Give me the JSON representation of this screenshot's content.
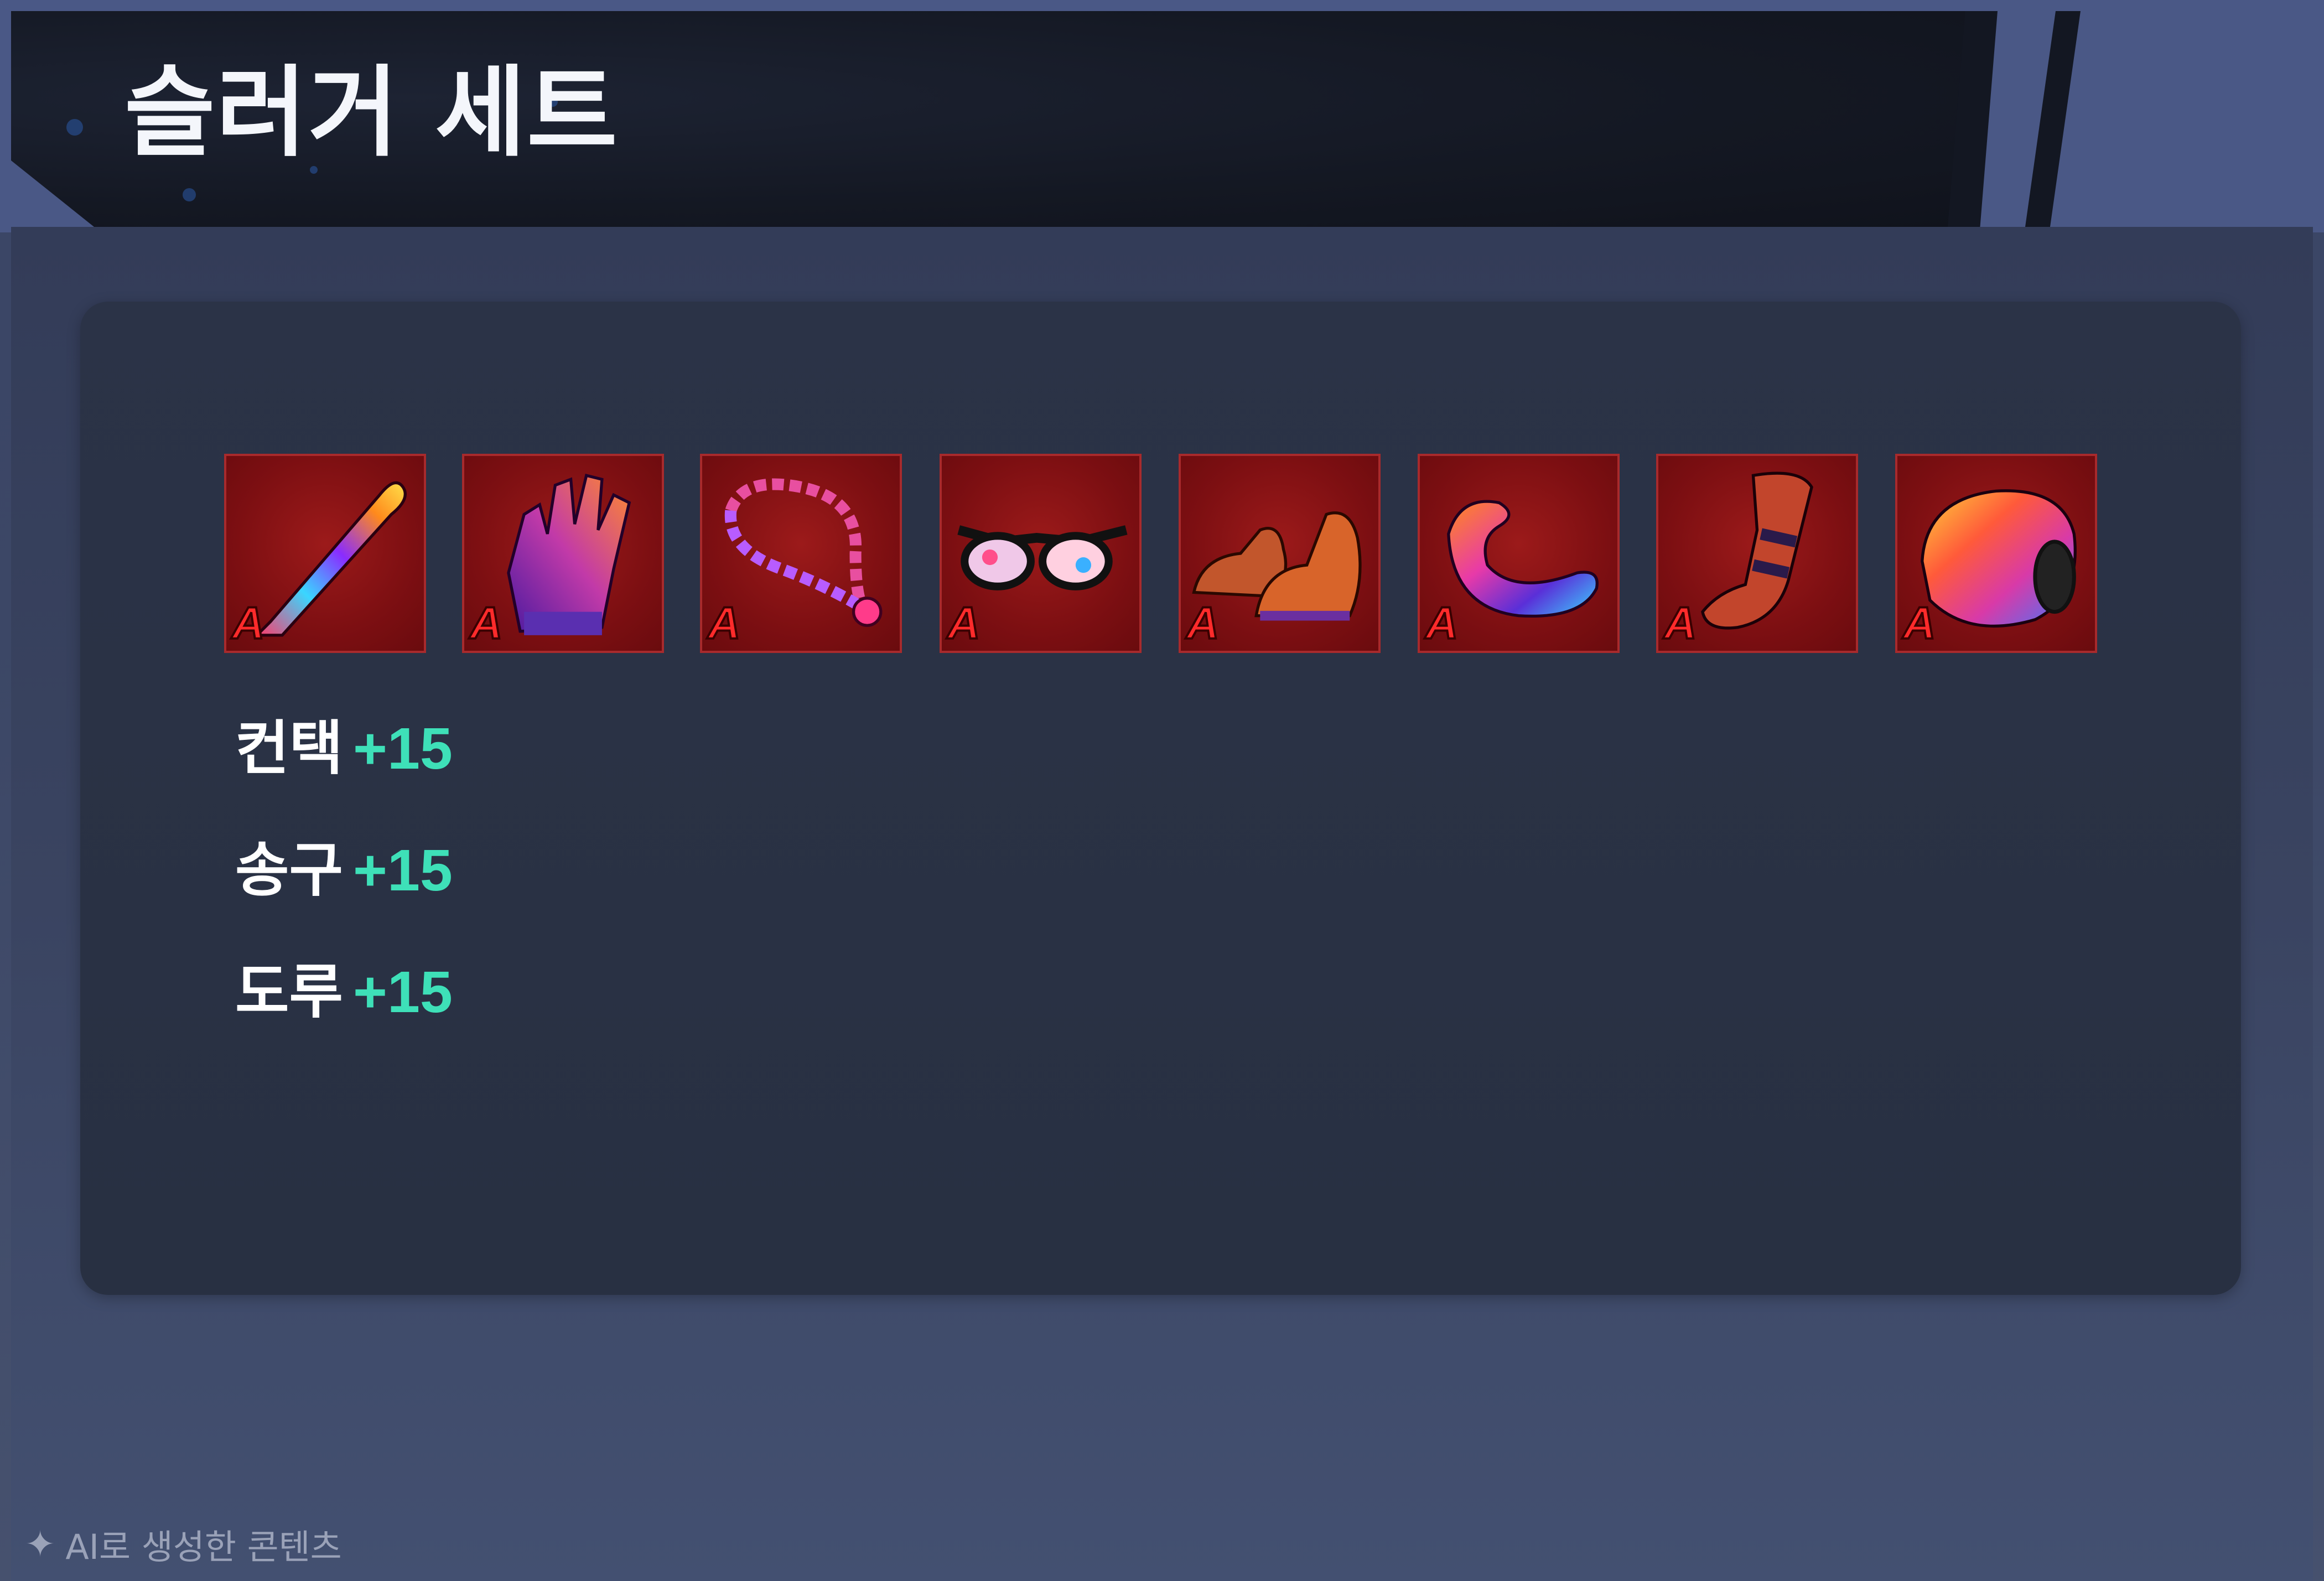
{
  "title": "슬러거 세트",
  "items": [
    {
      "icon": "bat-icon",
      "grade": "A"
    },
    {
      "icon": "glove-icon",
      "grade": "A"
    },
    {
      "icon": "necklace-icon",
      "grade": "A"
    },
    {
      "icon": "sunglasses-icon",
      "grade": "A"
    },
    {
      "icon": "cleats-icon",
      "grade": "A"
    },
    {
      "icon": "elbow-guard-icon",
      "grade": "A"
    },
    {
      "icon": "leg-guard-icon",
      "grade": "A"
    },
    {
      "icon": "wristband-icon",
      "grade": "A"
    }
  ],
  "stats": [
    {
      "label": "컨택",
      "value": "+15"
    },
    {
      "label": "송구",
      "value": "+15"
    },
    {
      "label": "도루",
      "value": "+15"
    }
  ],
  "footer": {
    "text": "AI로 생성한 콘텐츠",
    "icon": "sparkle-icon"
  },
  "colors": {
    "stat_value": "#3ee0b8",
    "grade": "#ff2b2b",
    "item_bg": "#7d0f12"
  }
}
